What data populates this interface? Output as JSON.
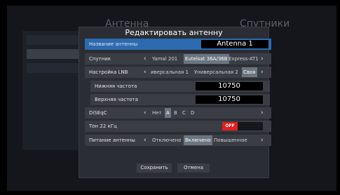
{
  "background": {
    "title_left": "Антенна",
    "title_right": "Спутники"
  },
  "dialog": {
    "title": "Редактировать антенну",
    "antenna_name": {
      "label": "Название антенны",
      "value": "Antenna 1"
    },
    "satellite": {
      "label": "Спутник",
      "options": [
        "Yamal 201",
        "Eutelsat 36A/36B",
        "Express-AT1"
      ],
      "active": 1
    },
    "lnb": {
      "label": "Настройка LNB",
      "options": [
        "иверсальная 1",
        "Универсальная 2",
        "Своя"
      ],
      "active": 2
    },
    "low_freq": {
      "label": "Нижняя частота",
      "value": "10750"
    },
    "high_freq": {
      "label": "Верхняя частота",
      "value": "10750"
    },
    "diseqc": {
      "label": "DiSEqC",
      "options": [
        "Нет",
        "A",
        "B",
        "C",
        "D"
      ],
      "active": 1
    },
    "tone": {
      "label": "Тон 22 кГц",
      "value": "OFF"
    },
    "power": {
      "label": "Питание антенны",
      "options": [
        "Отключено",
        "Включено",
        "Повышенное"
      ],
      "active": 1
    },
    "save_label": "Сохранить",
    "cancel_label": "Отмена"
  },
  "colors": {
    "selected_row": "#2c6bb0",
    "toggle_off": "#e02020",
    "active_option": "#6a7580"
  }
}
